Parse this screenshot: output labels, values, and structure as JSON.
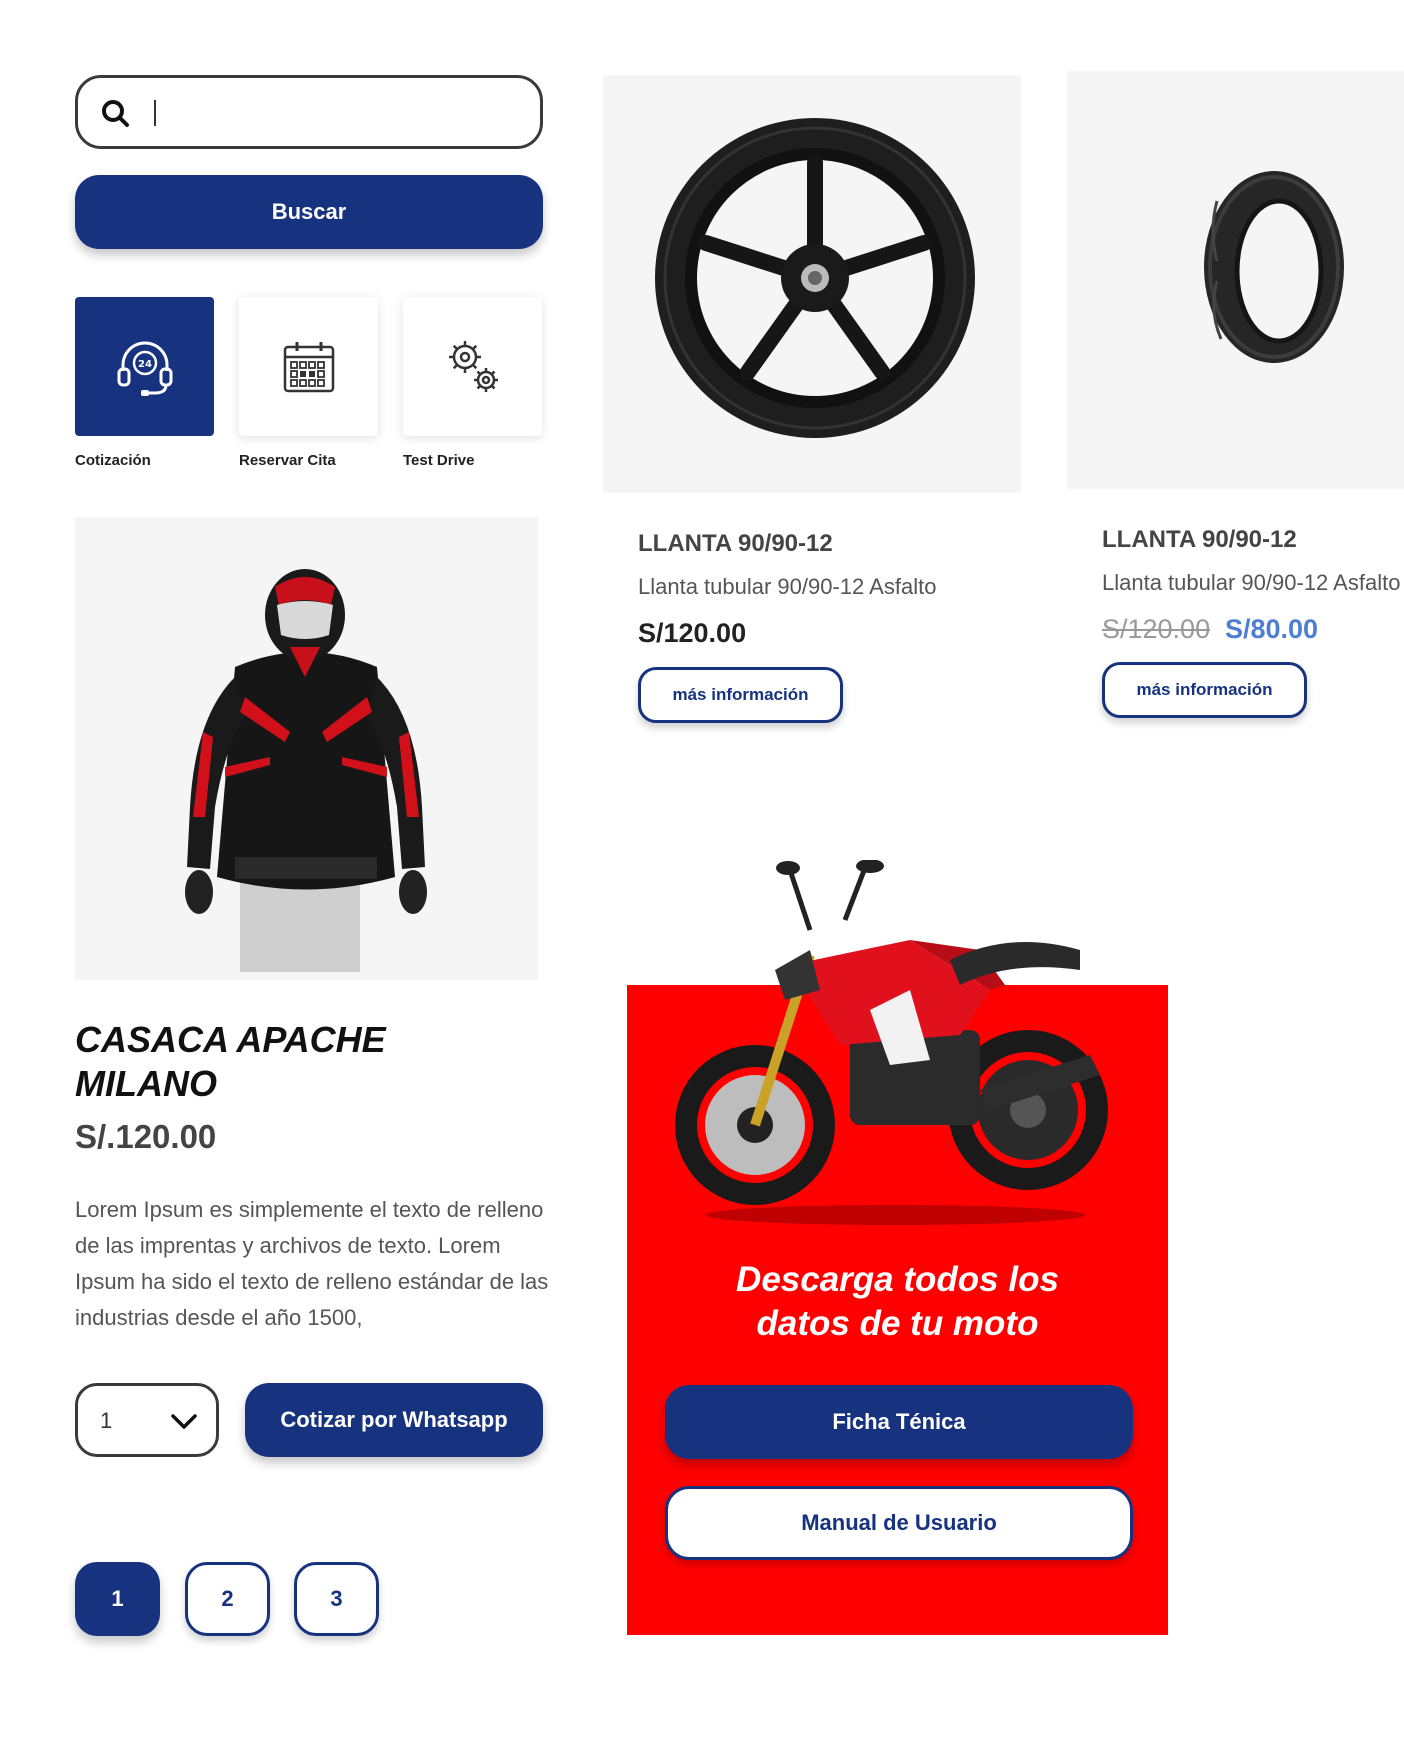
{
  "search": {
    "placeholder": "",
    "value": "",
    "button_label": "Buscar"
  },
  "quick_actions": [
    {
      "label": "Cotización",
      "icon": "headset-24-icon",
      "active": true
    },
    {
      "label": "Reservar Cita",
      "icon": "calendar-icon",
      "active": false
    },
    {
      "label": "Test Drive",
      "icon": "gears-icon",
      "active": false
    }
  ],
  "products": [
    {
      "title": "LLANTA 90/90-12",
      "description": "Llanta tubular 90/90-12 Asfalto",
      "price": "S/120.00",
      "button": "más información"
    },
    {
      "title": "LLANTA 90/90-12",
      "description": "Llanta tubular 90/90-12 Asfalto",
      "old_price": "S/120.00",
      "sale_price": "S/80.00",
      "button": "más información"
    }
  ],
  "featured": {
    "title_line1": "CASACA APACHE",
    "title_line2": "MILANO",
    "price": "S/.120.00",
    "description": "Lorem Ipsum es simplemente el texto de relleno de las imprentas y archivos de texto. Lorem Ipsum ha sido el texto de relleno estándar de las industrias desde el año 1500,",
    "quantity": "1",
    "whatsapp_button": "Cotizar por Whatsapp"
  },
  "pagination": [
    "1",
    "2",
    "3"
  ],
  "promo": {
    "line1": "Descarga todos los",
    "line2": "datos de tu moto",
    "ficha_button": "Ficha Ténica",
    "manual_button": "Manual de Usuario"
  },
  "colors": {
    "primary": "#17337f",
    "promo_red": "#ff0000",
    "sale_blue": "#4c7fd3",
    "panel_gray": "#f5f5f5"
  }
}
